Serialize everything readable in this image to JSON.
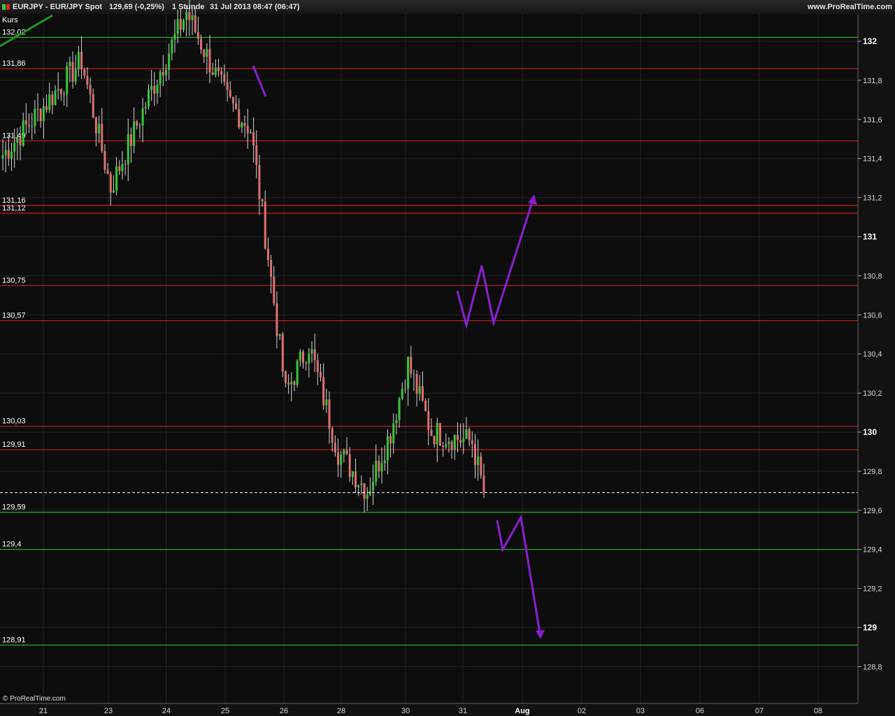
{
  "header": {
    "title": "EURJPY - EUR/JPY Spot",
    "quote": "129,69 (-0,25%)",
    "timeframe": "1 Stunde",
    "datetime": "31 Jul 2013 08:47 (06:47)",
    "site": "www.ProRealTime.com"
  },
  "chart_data": {
    "type": "candlestick",
    "series_label": "Kurs",
    "ylim": [
      128.7,
      132.2
    ],
    "y_ticks": [
      {
        "v": 132,
        "label": "132",
        "major": true
      },
      {
        "v": 131.8,
        "label": "131,8",
        "major": false
      },
      {
        "v": 131.6,
        "label": "131,6",
        "major": false
      },
      {
        "v": 131.4,
        "label": "131,4",
        "major": false
      },
      {
        "v": 131.2,
        "label": "131,2",
        "major": false
      },
      {
        "v": 131,
        "label": "131",
        "major": true
      },
      {
        "v": 130.8,
        "label": "130,8",
        "major": false
      },
      {
        "v": 130.6,
        "label": "130,6",
        "major": false
      },
      {
        "v": 130.4,
        "label": "130,4",
        "major": false
      },
      {
        "v": 130.2,
        "label": "130,2",
        "major": false
      },
      {
        "v": 130,
        "label": "130",
        "major": true
      },
      {
        "v": 129.8,
        "label": "129,8",
        "major": false
      },
      {
        "v": 129.6,
        "label": "129,6",
        "major": false
      },
      {
        "v": 129.4,
        "label": "129,4",
        "major": false
      },
      {
        "v": 129.2,
        "label": "129,2",
        "major": false
      },
      {
        "v": 129,
        "label": "129",
        "major": true
      },
      {
        "v": 128.8,
        "label": "128,8",
        "major": false
      }
    ],
    "x_ticks": [
      {
        "label": "21",
        "major": false
      },
      {
        "label": "23",
        "major": false
      },
      {
        "label": "24",
        "major": false
      },
      {
        "label": "25",
        "major": false
      },
      {
        "label": "26",
        "major": false
      },
      {
        "label": "28",
        "major": false
      },
      {
        "label": "30",
        "major": false
      },
      {
        "label": "31",
        "major": false
      },
      {
        "label": "Aug",
        "major": true
      },
      {
        "label": "02",
        "major": false
      },
      {
        "label": "03",
        "major": false
      },
      {
        "label": "06",
        "major": false
      },
      {
        "label": "07",
        "major": false
      },
      {
        "label": "08",
        "major": false
      }
    ],
    "levels": [
      {
        "v": 132.02,
        "label": "132,02",
        "color": "#2fd02f"
      },
      {
        "v": 131.86,
        "label": "131,86",
        "color": "#e02020"
      },
      {
        "v": 131.49,
        "label": "131,49",
        "color": "#e02020"
      },
      {
        "v": 131.16,
        "label": "131,16",
        "color": "#ff2020"
      },
      {
        "v": 131.12,
        "label": "131,12",
        "color": "#ff2020"
      },
      {
        "v": 130.75,
        "label": "130,75",
        "color": "#e02020"
      },
      {
        "v": 130.57,
        "label": "130,57",
        "color": "#e02020"
      },
      {
        "v": 130.03,
        "label": "130,03",
        "color": "#e02020"
      },
      {
        "v": 129.91,
        "label": "129,91",
        "color": "#e02020"
      },
      {
        "v": 129.59,
        "label": "129,59",
        "color": "#2fd02f"
      },
      {
        "v": 129.4,
        "label": "129,4",
        "color": "#2fd02f"
      },
      {
        "v": 128.91,
        "label": "128,91",
        "color": "#2fd02f"
      }
    ],
    "last_price": {
      "v": 129.69,
      "label": "129,69"
    },
    "segments": [
      {
        "from": 131.4,
        "to": 131.9,
        "n": 28
      },
      {
        "from": 131.9,
        "to": 131.25,
        "n": 10
      },
      {
        "from": 131.25,
        "to": 131.75,
        "n": 14
      },
      {
        "from": 131.75,
        "to": 132.15,
        "n": 12
      },
      {
        "from": 132.15,
        "to": 131.7,
        "n": 14
      },
      {
        "from": 131.7,
        "to": 131.55,
        "n": 8
      },
      {
        "from": 131.55,
        "to": 130.9,
        "n": 6
      },
      {
        "from": 130.9,
        "to": 130.2,
        "n": 6
      },
      {
        "from": 130.2,
        "to": 130.45,
        "n": 8
      },
      {
        "from": 130.45,
        "to": 129.9,
        "n": 10
      },
      {
        "from": 129.9,
        "to": 129.7,
        "n": 10
      },
      {
        "from": 129.7,
        "to": 130.0,
        "n": 8
      },
      {
        "from": 130.0,
        "to": 130.35,
        "n": 6
      },
      {
        "from": 130.35,
        "to": 130.0,
        "n": 8
      },
      {
        "from": 130.0,
        "to": 129.95,
        "n": 14
      },
      {
        "from": 129.95,
        "to": 129.69,
        "n": 4
      }
    ],
    "colors": {
      "up": "#38c838",
      "down": "#e07070",
      "wick": "#d8d8d8",
      "annotation": "#8a1fd0",
      "trend": "#1e9a1e",
      "last_price_bg": "#f0d000"
    },
    "watermark": "© ProRealTime.com"
  }
}
